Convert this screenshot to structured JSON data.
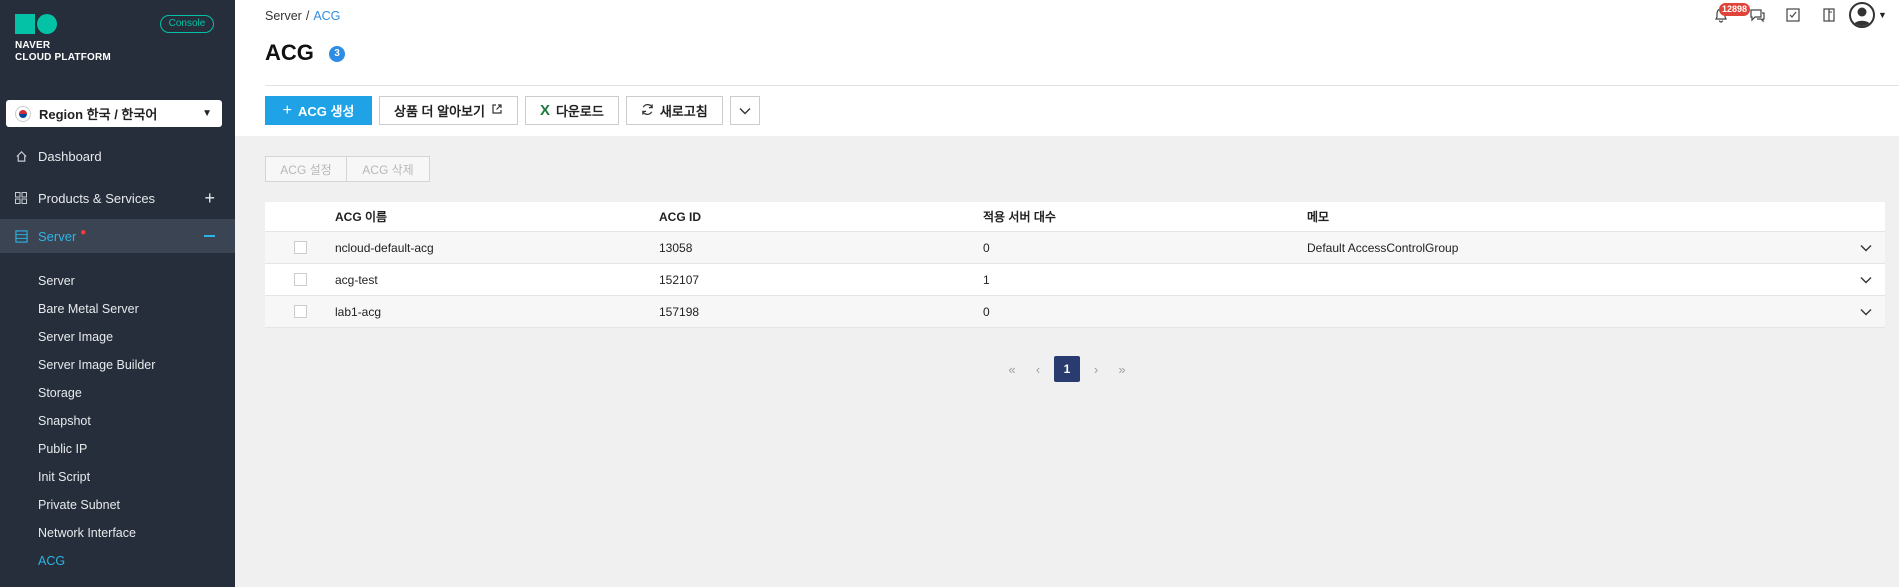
{
  "sidebar": {
    "logo_line1": "NAVER",
    "logo_line2": "CLOUD PLATFORM",
    "console_label": "Console",
    "region_label": "Region 한국 / 한국어",
    "nav": {
      "dashboard": "Dashboard",
      "products": "Products & Services",
      "server": "Server"
    },
    "sub_items": [
      "Server",
      "Bare Metal Server",
      "Server Image",
      "Server Image Builder",
      "Storage",
      "Snapshot",
      "Public IP",
      "Init Script",
      "Private Subnet",
      "Network Interface",
      "ACG"
    ],
    "active_sub": "ACG"
  },
  "header": {
    "breadcrumb_root": "Server",
    "breadcrumb_sep": "/",
    "breadcrumb_current": "ACG",
    "title": "ACG",
    "count": "3",
    "notification_count": "12898"
  },
  "toolbar": {
    "create": "ACG 생성",
    "learn_more": "상품 더 알아보기",
    "download": "다운로드",
    "refresh": "새로고침"
  },
  "actions": {
    "settings": "ACG 설정",
    "delete": "ACG 삭제"
  },
  "table": {
    "headers": [
      "ACG 이름",
      "ACG ID",
      "적용 서버 대수",
      "메모"
    ],
    "rows": [
      [
        "ncloud-default-acg",
        "13058",
        "0",
        "Default AccessControlGroup"
      ],
      [
        "acg-test",
        "152107",
        "1",
        ""
      ],
      [
        "lab1-acg",
        "157198",
        "0",
        ""
      ]
    ]
  },
  "pagination": {
    "current": "1"
  },
  "colors": {
    "accent": "#1fa3e6",
    "sidebar_bg": "#252e3a",
    "brand": "#03c2a6",
    "page_active": "#2a3b70"
  }
}
